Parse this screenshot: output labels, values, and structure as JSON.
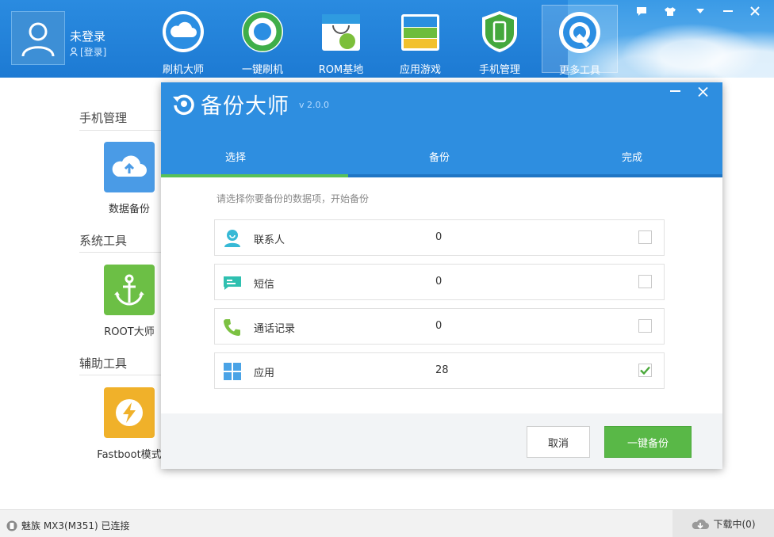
{
  "header": {
    "user_name": "未登录",
    "login_link": "[登录]",
    "nav": [
      {
        "label": "刷机大师",
        "icon": "cloud-icon"
      },
      {
        "label": "一键刷机",
        "icon": "refresh-icon"
      },
      {
        "label": "ROM基地",
        "icon": "android-bag-icon"
      },
      {
        "label": "应用游戏",
        "icon": "apps-stack-icon"
      },
      {
        "label": "手机管理",
        "icon": "phone-shield-icon"
      },
      {
        "label": "更多工具",
        "icon": "wrench-gear-icon"
      }
    ],
    "window_controls": [
      "feedback-icon",
      "skin-icon",
      "menu-down-icon",
      "minimize-icon",
      "close-icon"
    ],
    "colors": {
      "brand_blue": "#1d7ad3",
      "accent_green": "#59b847"
    }
  },
  "sidebar": {
    "sections": [
      {
        "title": "手机管理",
        "tool": {
          "label": "数据备份",
          "icon": "cloud-upload-icon",
          "color": "#4a9be6"
        }
      },
      {
        "title": "系统工具",
        "tool": {
          "label": "ROOT大师",
          "icon": "anchor-icon",
          "color": "#6cbf45"
        }
      },
      {
        "title": "辅助工具",
        "tool": {
          "label": "Fastboot模式",
          "icon": "lightning-icon",
          "color": "#f0b12a"
        }
      }
    ]
  },
  "dialog": {
    "title": "备份大师",
    "version": "v 2.0.0",
    "steps": [
      "选择",
      "备份",
      "完成"
    ],
    "active_step": 0,
    "hint": "请选择你要备份的数据项，开始备份",
    "items": [
      {
        "label": "联系人",
        "count": "0",
        "icon": "contact-icon",
        "checked": false
      },
      {
        "label": "短信",
        "count": "0",
        "icon": "sms-icon",
        "checked": false
      },
      {
        "label": "通话记录",
        "count": "0",
        "icon": "phone-call-icon",
        "checked": false
      },
      {
        "label": "应用",
        "count": "28",
        "icon": "apps-grid-icon",
        "checked": true
      }
    ],
    "cancel_label": "取消",
    "backup_label": "一键备份"
  },
  "statusbar": {
    "device": "魅族 MX3(M351) 已连接",
    "download": "下载中(0)"
  }
}
